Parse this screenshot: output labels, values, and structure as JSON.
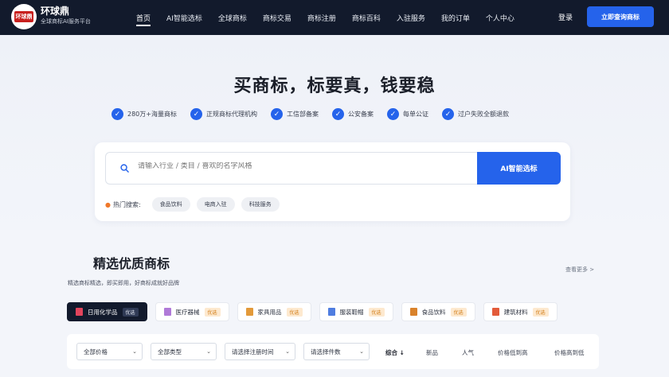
{
  "brand": {
    "logo_text": "环球鼎",
    "name": "环球鼎",
    "subtitle": "全球商标AI服务平台"
  },
  "nav": {
    "items": [
      "首页",
      "AI智能选标",
      "全球商标",
      "商标交易",
      "商标注册",
      "商标百科",
      "入驻服务",
      "我的订单",
      "个人中心"
    ],
    "active": "首页",
    "login": "登录",
    "cta": "立即查询商标"
  },
  "hero": {
    "title": "买商标，标要真，钱要稳",
    "features": [
      "280万+海量商标",
      "正规商标代理机构",
      "工信部备案",
      "公安备案",
      "每单公证",
      "过户失败全额退款"
    ]
  },
  "search": {
    "placeholder": "请输入行业 / 类目 / 喜欢的名字风格",
    "button": "AI智能选标",
    "hot_label": "热门搜索:",
    "hot_tags": [
      "食品饮料",
      "电商入驻",
      "科技服务"
    ]
  },
  "section": {
    "title": "精选优质商标",
    "subtitle": "精选商标精选，即买即用，好商标成就好品牌",
    "see_more": "查看更多 >"
  },
  "categories": [
    {
      "label": "日用化学品",
      "badge": "优选",
      "active": true,
      "icon": "bottle-icon",
      "color": "#e2445c"
    },
    {
      "label": "医疗器械",
      "badge": "优选",
      "active": false,
      "icon": "medical-icon",
      "color": "#b07ad8"
    },
    {
      "label": "家具用品",
      "badge": "优选",
      "active": false,
      "icon": "house-icon",
      "color": "#e39a3a"
    },
    {
      "label": "服装鞋帽",
      "badge": "优选",
      "active": false,
      "icon": "clothing-icon",
      "color": "#4f7de0"
    },
    {
      "label": "食品饮料",
      "badge": "优选",
      "active": false,
      "icon": "food-icon",
      "color": "#d9822b"
    },
    {
      "label": "建筑材料",
      "badge": "优选",
      "active": false,
      "icon": "building-icon",
      "color": "#e35b3a"
    }
  ],
  "filters": {
    "selects": [
      "全部价格",
      "全部类型",
      "请选择注册时间",
      "请选择件数"
    ],
    "sorts": [
      "综合 ↓",
      "新品",
      "人气",
      "价格低到高",
      "价格高到低"
    ]
  },
  "colors": {
    "primary": "#2563eb",
    "nav_bg": "#121a2c"
  }
}
